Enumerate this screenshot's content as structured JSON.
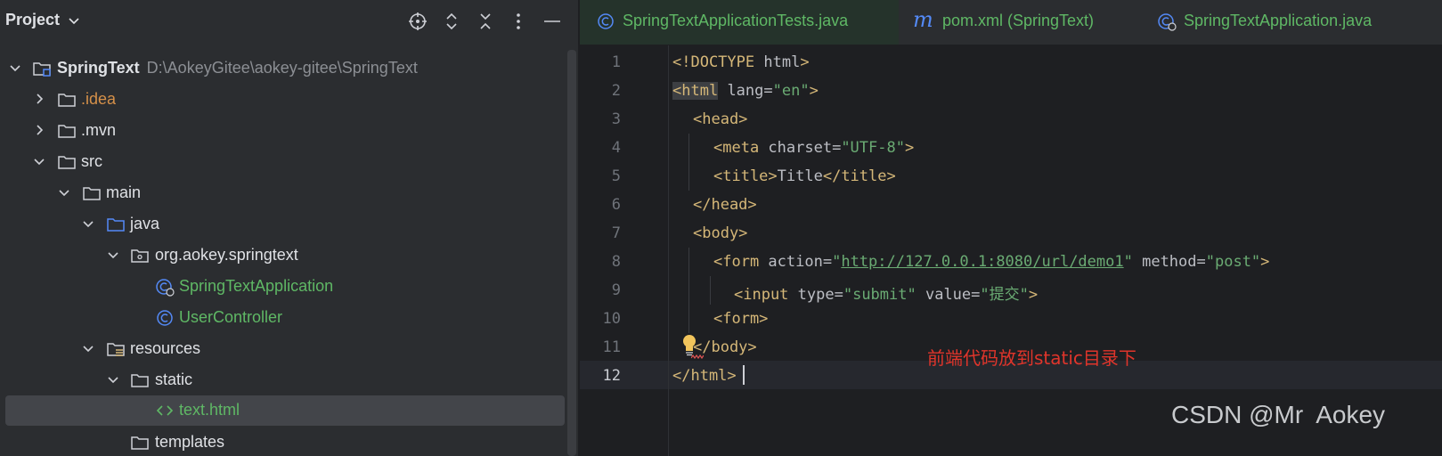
{
  "project": {
    "title": "Project",
    "root_name": "SpringText",
    "root_path": "D:\\AokeyGitee\\aokey-gitee\\SpringText",
    "items": [
      {
        "label": ".idea"
      },
      {
        "label": ".mvn"
      },
      {
        "label": "src"
      },
      {
        "label": "main"
      },
      {
        "label": "java"
      },
      {
        "label": "org.aokey.springtext"
      },
      {
        "label": "SpringTextApplication"
      },
      {
        "label": "UserController"
      },
      {
        "label": "resources"
      },
      {
        "label": "static"
      },
      {
        "label": "text.html"
      },
      {
        "label": "templates"
      }
    ],
    "header_icons": [
      "locate-icon",
      "expand-icon",
      "collapse-icon",
      "more-icon",
      "minimize-icon"
    ]
  },
  "tabs": [
    {
      "label": "SpringTextApplicationTests.java",
      "icon": "class-icon",
      "active": true
    },
    {
      "label": "pom.xml (SpringText)",
      "icon": "maven-icon",
      "active": false
    },
    {
      "label": "SpringTextApplication.java",
      "icon": "spring-class-icon",
      "active": false
    }
  ],
  "editor": {
    "line_numbers": [
      "1",
      "2",
      "3",
      "4",
      "5",
      "6",
      "7",
      "8",
      "9",
      "10",
      "11",
      "12"
    ],
    "code": {
      "l1_doctype": "<!DOCTYPE",
      "l1_html": " html",
      "l1_end": ">",
      "l2_open": "<",
      "l2_tag": "html",
      "l2_attr": " lang=",
      "l2_val": "\"en\"",
      "l2_end": ">",
      "l3": "<head>",
      "l4_tag": "<meta",
      "l4_attr": " charset=",
      "l4_val": "\"UTF-8\"",
      "l4_end": ">",
      "l5_open": "<title>",
      "l5_text": "Title",
      "l5_close": "</title>",
      "l6": "</head>",
      "l7": "<body>",
      "l8_tag": "<form",
      "l8_attr": " action=",
      "l8_q1": "\"",
      "l8_url": "http://127.0.0.1:8080/url/demo1",
      "l8_q2": "\"",
      "l8_attr2": " method=",
      "l8_val2": "\"post\"",
      "l8_end": ">",
      "l9_tag": "<input",
      "l9_attr": " type=",
      "l9_val": "\"submit\"",
      "l9_attr2": " value=",
      "l9_val2": "\"提交\"",
      "l9_end": ">",
      "l10": "<form>",
      "l11": "</body>",
      "l12": "</html>"
    },
    "annotation": "前端代码放到static目录下"
  },
  "watermark": "CSDN @Mr  Aokey",
  "colors": {
    "accent_green": "#5fb865",
    "folder_blue": "#548af7",
    "annotation_red": "#e0352b"
  }
}
